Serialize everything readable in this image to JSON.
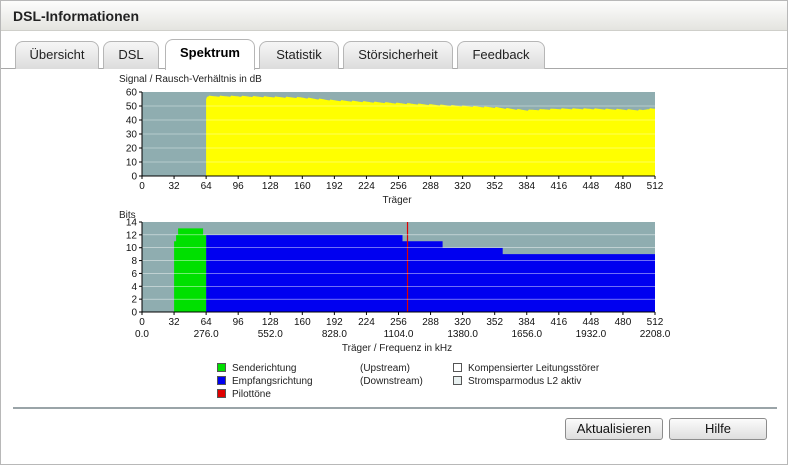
{
  "window": {
    "title": "DSL-Informationen"
  },
  "tabs": [
    {
      "label": "Übersicht",
      "active": false
    },
    {
      "label": "DSL",
      "active": false
    },
    {
      "label": "Spektrum",
      "active": true
    },
    {
      "label": "Statistik",
      "active": false
    },
    {
      "label": "Störsicherheit",
      "active": false
    },
    {
      "label": "Feedback",
      "active": false
    }
  ],
  "colors": {
    "plot_bg": "#8fadb0",
    "snr": "#ffff00",
    "upstream": "#00e000",
    "downstream": "#0000f0",
    "pilot": "#e00000"
  },
  "chart_data": [
    {
      "type": "area",
      "title": "Signal / Rausch-Verhältnis in dB",
      "xlabel": "Träger",
      "ylabel": "",
      "xlim": [
        0,
        512
      ],
      "ylim": [
        0,
        60
      ],
      "grid": true,
      "x_ticks": [
        "0",
        "32",
        "64",
        "96",
        "128",
        "160",
        "192",
        "224",
        "256",
        "288",
        "320",
        "352",
        "384",
        "416",
        "448",
        "480",
        "512"
      ],
      "y_ticks": [
        "0",
        "10",
        "20",
        "30",
        "40",
        "50",
        "60"
      ],
      "series": [
        {
          "x": [
            64,
            65,
            96,
            128,
            160,
            192,
            224,
            256,
            288,
            320,
            352,
            384,
            416,
            448,
            480,
            500,
            505,
            512
          ],
          "values": [
            55,
            57,
            57,
            56.5,
            56,
            54,
            53,
            52,
            51,
            50,
            49,
            47,
            48,
            48,
            47.5,
            47,
            48,
            48
          ]
        }
      ]
    },
    {
      "type": "bar",
      "title": "Bits",
      "xlabel": "Träger / Frequenz in kHz",
      "ylabel": "",
      "xlim": [
        0,
        512
      ],
      "ylim": [
        0,
        14
      ],
      "grid": true,
      "x_ticks": [
        "0",
        "32",
        "64",
        "96",
        "128",
        "160",
        "192",
        "224",
        "256",
        "288",
        "320",
        "352",
        "384",
        "416",
        "448",
        "480",
        "512"
      ],
      "x_ticks_freq": [
        "0.0",
        "276.0",
        "552.0",
        "828.0",
        "1104.0",
        "1380.0",
        "1656.0",
        "1932.0",
        "2208.0"
      ],
      "y_ticks": [
        "0",
        "2",
        "4",
        "6",
        "8",
        "10",
        "12",
        "14"
      ],
      "pilot_carrier": 265,
      "series": [
        {
          "name": "Senderichtung",
          "x": [
            32,
            34,
            36,
            60,
            61,
            64
          ],
          "values": [
            11,
            12,
            13,
            13,
            12,
            11
          ]
        },
        {
          "name": "Empfangsrichtung",
          "x": [
            64,
            100,
            180,
            220,
            260,
            300,
            340,
            355,
            360,
            500,
            512
          ],
          "values": [
            12,
            12,
            12,
            12,
            11,
            10,
            10,
            10,
            9,
            9,
            8
          ]
        }
      ]
    }
  ],
  "legend": {
    "upstream_label": "Senderichtung",
    "upstream_note": "(Upstream)",
    "downstream_label": "Empfangsrichtung",
    "downstream_note": "(Downstream)",
    "pilot_label": "Pilottöne",
    "comp_label": "Kompensierter Leitungsstörer",
    "l2_label": "Stromsparmodus L2 aktiv"
  },
  "buttons": {
    "refresh_label": "Aktualisieren",
    "help_label": "Hilfe"
  }
}
